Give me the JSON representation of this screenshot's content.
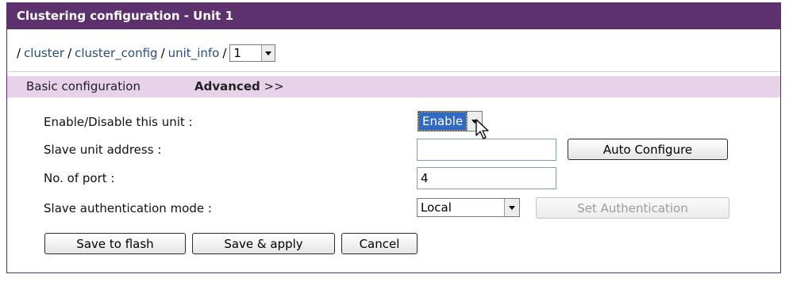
{
  "window": {
    "title": "Clustering configuration - Unit 1"
  },
  "breadcrumb": {
    "lead_sep": "/",
    "items": [
      "cluster",
      "cluster_config",
      "unit_info"
    ],
    "sep": "/",
    "unit_select": {
      "value": "1"
    }
  },
  "tabs": {
    "basic": "Basic configuration",
    "advanced": "Advanced",
    "advanced_suffix": ">>"
  },
  "form": {
    "enable": {
      "label": "Enable/Disable this unit :",
      "value": "Enable"
    },
    "slave_address": {
      "label": "Slave unit address :",
      "value": ""
    },
    "ports": {
      "label": "No. of port :",
      "value": "4"
    },
    "auth_mode": {
      "label": "Slave authentication mode :",
      "value": "Local"
    }
  },
  "buttons": {
    "auto_configure": "Auto Configure",
    "set_authentication": "Set Authentication",
    "save_flash": "Save to flash",
    "save_apply": "Save & apply",
    "cancel": "Cancel"
  },
  "colors": {
    "title_bg": "#5d306e",
    "tab_bg": "#e7d2ea",
    "link": "#2a4a8a",
    "selection": "#316ac5"
  }
}
